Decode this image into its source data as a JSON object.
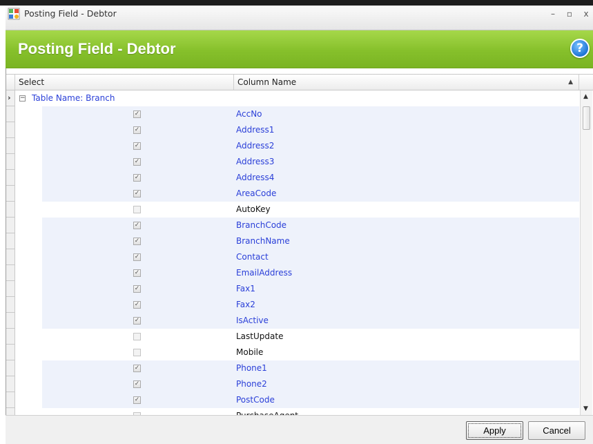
{
  "window": {
    "title": "Posting Field - Debtor",
    "minimize_glyph": "–",
    "maximize_glyph": "▫",
    "close_glyph": "x"
  },
  "header": {
    "title": "Posting Field - Debtor",
    "help_glyph": "?"
  },
  "grid": {
    "columns": {
      "select": "Select",
      "column_name": "Column Name"
    },
    "group_label": "Table Name: Branch",
    "rows": [
      {
        "name": "AccNo",
        "checked": true
      },
      {
        "name": "Address1",
        "checked": true
      },
      {
        "name": "Address2",
        "checked": true
      },
      {
        "name": "Address3",
        "checked": true
      },
      {
        "name": "Address4",
        "checked": true
      },
      {
        "name": "AreaCode",
        "checked": true
      },
      {
        "name": "AutoKey",
        "checked": false
      },
      {
        "name": "BranchCode",
        "checked": true
      },
      {
        "name": "BranchName",
        "checked": true
      },
      {
        "name": "Contact",
        "checked": true
      },
      {
        "name": "EmailAddress",
        "checked": true
      },
      {
        "name": "Fax1",
        "checked": true
      },
      {
        "name": "Fax2",
        "checked": true
      },
      {
        "name": "IsActive",
        "checked": true
      },
      {
        "name": "LastUpdate",
        "checked": false
      },
      {
        "name": "Mobile",
        "checked": false
      },
      {
        "name": "Phone1",
        "checked": true
      },
      {
        "name": "Phone2",
        "checked": true
      },
      {
        "name": "PostCode",
        "checked": true
      },
      {
        "name": "PurchaseAgent",
        "checked": false
      }
    ]
  },
  "footer": {
    "apply_label": "Apply",
    "cancel_label": "Cancel"
  },
  "colors": {
    "header_green": "#86c02b",
    "checked_text": "#2a3fd8",
    "alt_row": "#eef2fb"
  }
}
